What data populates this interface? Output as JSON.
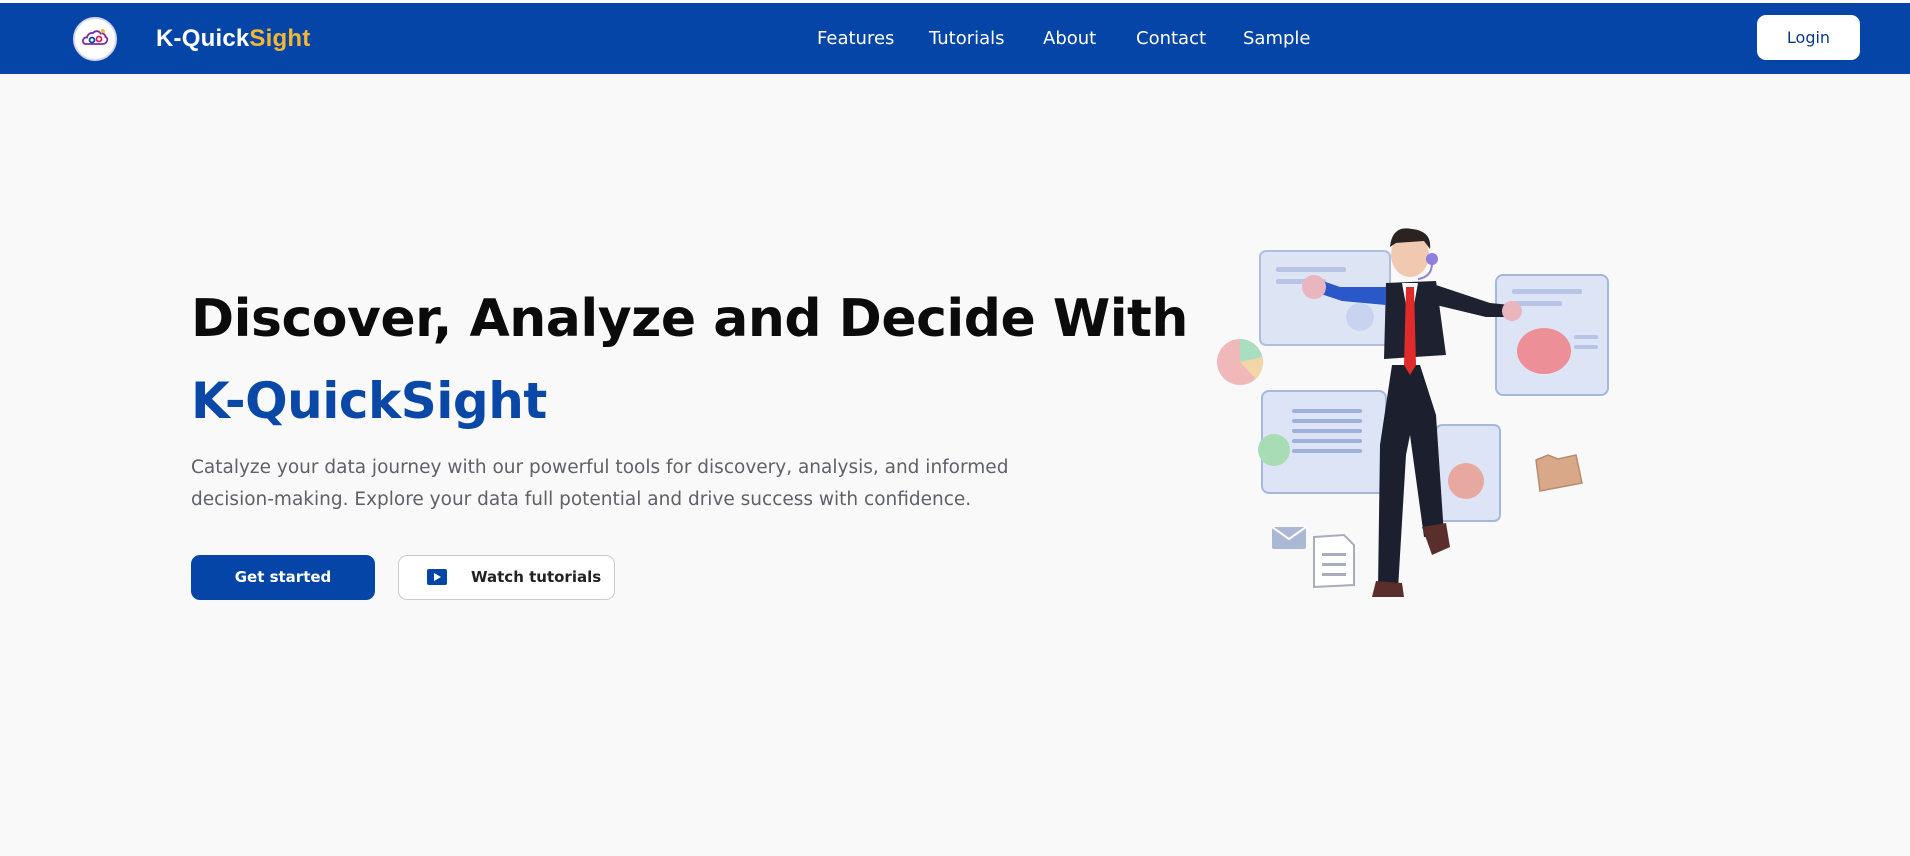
{
  "header": {
    "brand_primary": "K-Quick",
    "brand_accent": "Sight",
    "nav": [
      "Features",
      "Tutorials",
      "About",
      "Contact",
      "Sample"
    ],
    "login_label": "Login"
  },
  "hero": {
    "title": "Discover, Analyze and Decide With",
    "brand": "K-QuickSight",
    "description": "Catalyze your data journey with our powerful tools for discovery, analysis, and informed decision-making. Explore your data full potential and drive success with confidence.",
    "primary_button": "Get started",
    "secondary_button": "Watch tutorials"
  },
  "colors": {
    "header_bg": "#0645a8",
    "brand_accent": "#f5b731",
    "primary": "#0645a8",
    "page_bg": "#f9f9f9"
  },
  "icons": {
    "logo": "cloud-analytics-logo-icon",
    "play": "play-icon"
  }
}
